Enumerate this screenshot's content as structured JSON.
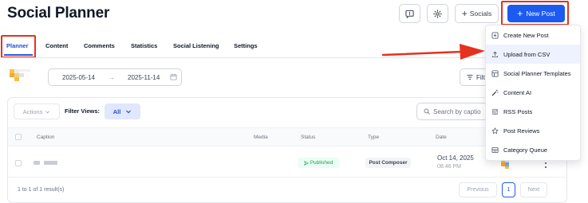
{
  "header": {
    "title": "Social Planner",
    "socials_label": "Socials",
    "new_post_label": "New Post"
  },
  "tabs": [
    "Planner",
    "Content",
    "Comments",
    "Statistics",
    "Social Listening",
    "Settings"
  ],
  "filters": {
    "start_date": "2025-05-14",
    "end_date": "2025-11-14",
    "filter_label": "Filt",
    "actions_label": "Actions",
    "filter_views_label": "Filter Views:",
    "filter_views_value": "All",
    "search_placeholder": "Search by captio"
  },
  "table": {
    "columns": [
      "Caption",
      "Media",
      "Status",
      "Type",
      "Date"
    ],
    "rows": [
      {
        "status": "Published",
        "type": "Post Composer",
        "date": "Oct 14, 2025",
        "time": "08:46 PM"
      }
    ]
  },
  "pagination": {
    "summary": "1 to 1 of 1 result(s)",
    "previous": "Previous",
    "page": "1",
    "next": "Next"
  },
  "menu": {
    "items": [
      {
        "label": "Create New Post",
        "icon": "plus-square-icon"
      },
      {
        "label": "Upload from CSV",
        "icon": "upload-icon"
      },
      {
        "label": "Social Planner Templates",
        "icon": "template-icon"
      },
      {
        "label": "Content AI",
        "icon": "magic-wand-icon"
      },
      {
        "label": "RSS Posts",
        "icon": "rss-icon"
      },
      {
        "label": "Post Reviews",
        "icon": "star-icon"
      },
      {
        "label": "Category Queue",
        "icon": "queue-icon"
      }
    ]
  },
  "colors": {
    "primary": "#1d5bf0",
    "highlight": "#e5321e",
    "published": "#16a34a"
  }
}
